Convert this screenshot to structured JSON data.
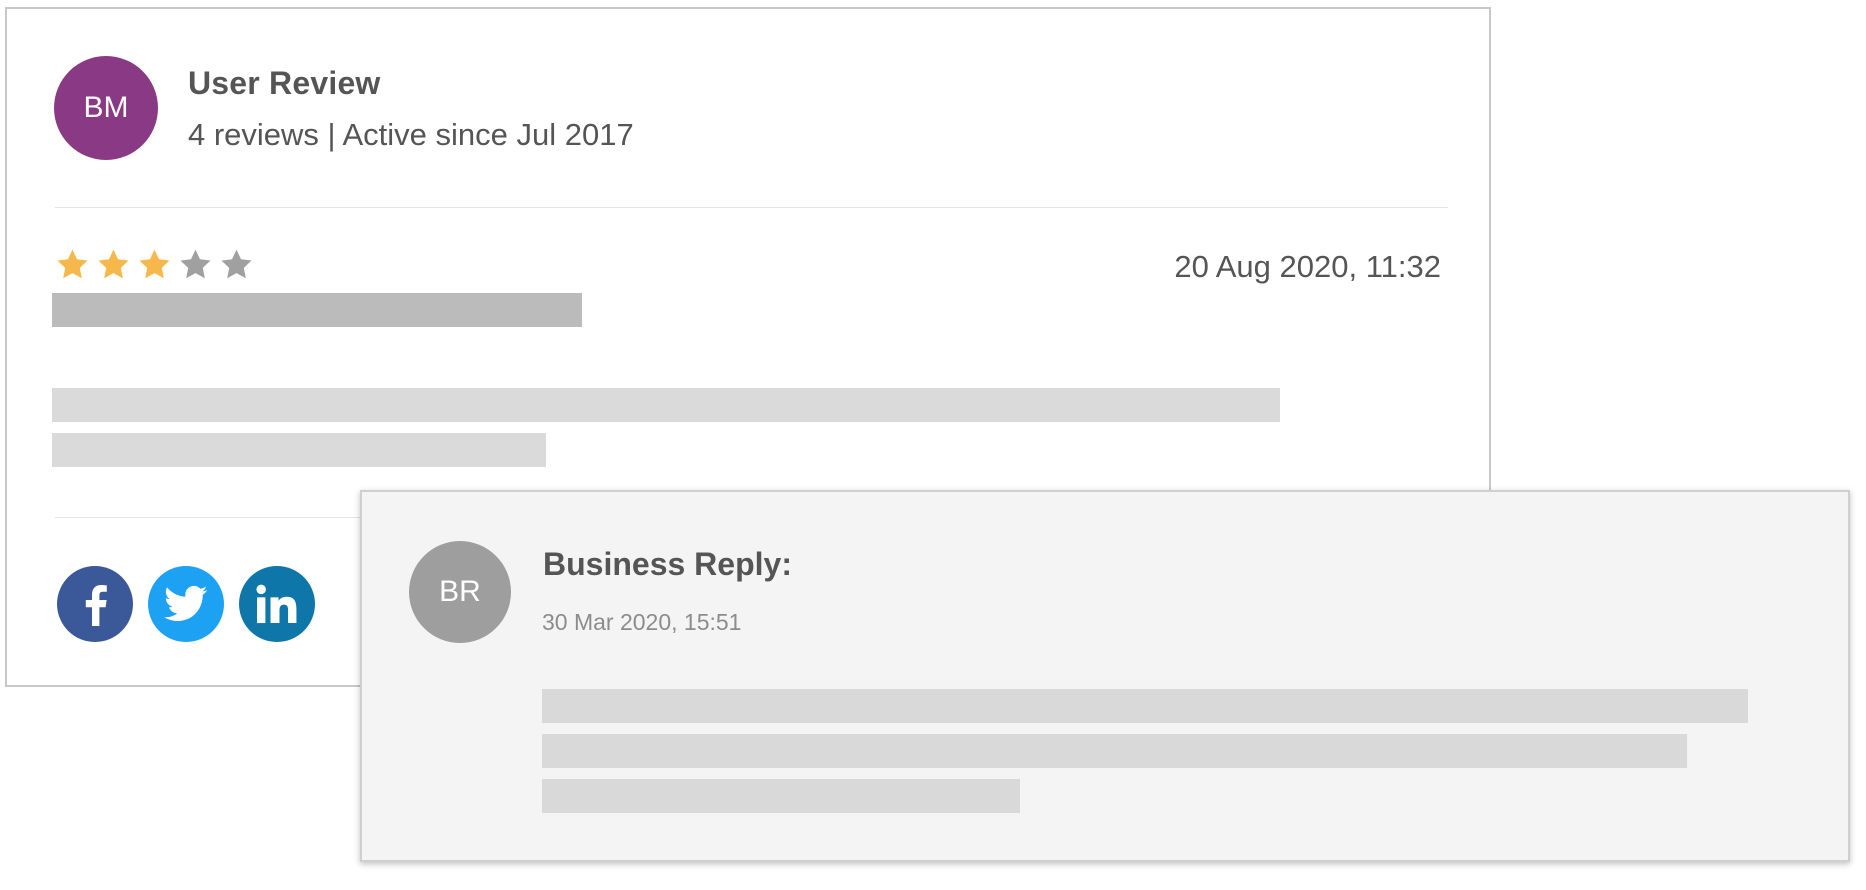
{
  "review": {
    "avatar_initials": "BM",
    "title": "User Review",
    "meta": "4 reviews | Active since Jul 2017",
    "rating": {
      "value": 3,
      "max": 5
    },
    "date": "20 Aug 2020, 11:32",
    "colors": {
      "avatar": "#8a3a85",
      "star_filled": "#f7b84b",
      "star_empty": "#a0a0a0"
    }
  },
  "social": {
    "icons": [
      "facebook-icon",
      "twitter-icon",
      "linkedin-icon"
    ],
    "colors": {
      "facebook": "#3b5998",
      "twitter": "#1da1f2",
      "linkedin": "#0e76a8"
    }
  },
  "reply": {
    "avatar_initials": "BR",
    "title": "Business Reply:",
    "date": "30 Mar 2020, 15:51",
    "colors": {
      "avatar": "#9e9e9e",
      "background": "#f4f4f4"
    }
  }
}
